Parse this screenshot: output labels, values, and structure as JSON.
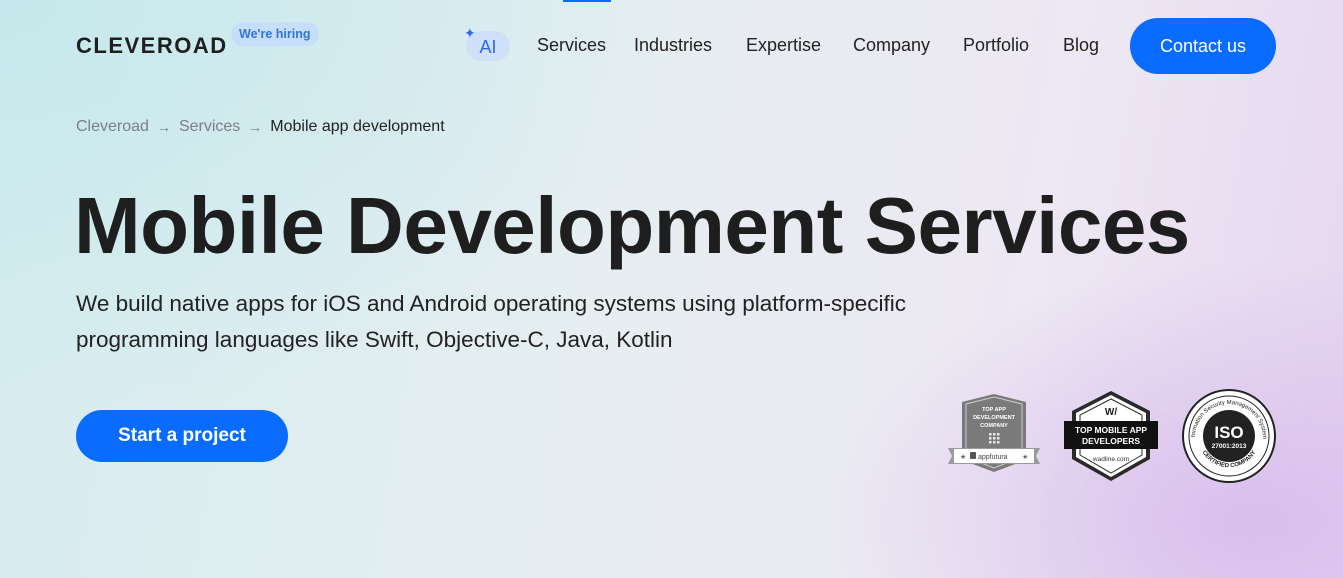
{
  "header": {
    "logo": "CLEVEROAD",
    "hiring_badge": "We're hiring",
    "nav": {
      "ai": "AI",
      "items": [
        "Services",
        "Industries",
        "Expertise",
        "Company",
        "Portfolio",
        "Blog"
      ]
    },
    "cta": "Contact us"
  },
  "breadcrumb": {
    "items": [
      "Cleveroad",
      "Services",
      "Mobile app development"
    ]
  },
  "hero": {
    "title": "Mobile Development Services",
    "subtitle": "We build native apps for iOS and Android operating systems using platform-specific programming languages like Swift, Objective-C, Java, Kotlin",
    "button": "Start a project"
  },
  "badges": {
    "appfutura": {
      "line1": "TOP APP",
      "line2": "DEVELOPMENT",
      "line3": "COMPANY",
      "brand": "appfutura"
    },
    "wadline": {
      "mark": "W/",
      "line1": "TOP MOBILE APP",
      "line2": "DEVELOPERS",
      "site": "wadline.com"
    },
    "iso": {
      "ring_top": "Information Security Management Systems",
      "center_big": "ISO",
      "center_small": "27001:2013",
      "ring_bottom": "CERTIFIED COMPANY"
    }
  },
  "colors": {
    "accent": "#0a6cff",
    "text": "#1e1e1e",
    "muted": "#7b8088"
  },
  "icons": {
    "sparkle": "sparkle-icon",
    "breadcrumb_separator": "arrow-right-icon"
  }
}
